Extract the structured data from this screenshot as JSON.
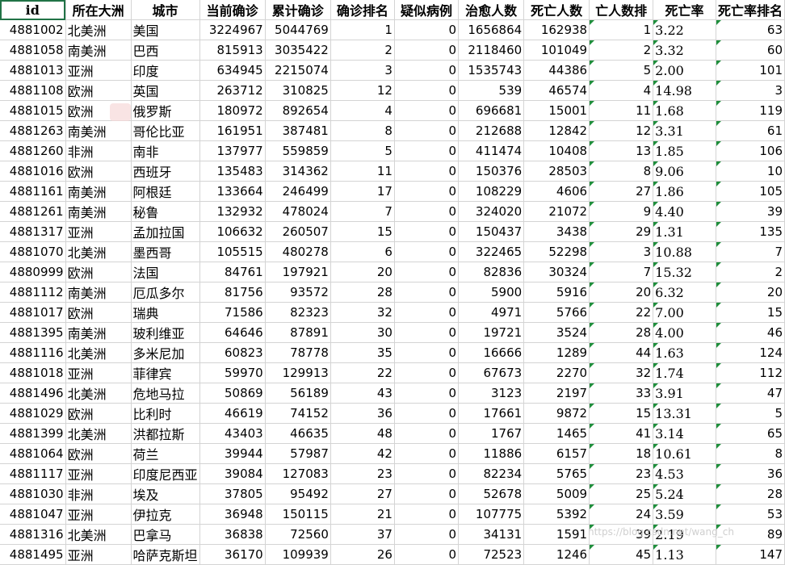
{
  "columns": [
    "id",
    "所在大洲",
    "城市",
    "当前确诊",
    "累计确诊",
    "确诊排名",
    "疑似病例",
    "治愈人数",
    "死亡人数",
    "亡人数排",
    "死亡率",
    "死亡率排名"
  ],
  "rows": [
    [
      "4881002",
      "北美洲",
      "美国",
      "3224967",
      "5044769",
      "1",
      "0",
      "1656864",
      "162938",
      "1",
      "3.22",
      "63"
    ],
    [
      "4881058",
      "南美洲",
      "巴西",
      "815913",
      "3035422",
      "2",
      "0",
      "2118460",
      "101049",
      "2",
      "3.32",
      "60"
    ],
    [
      "4881013",
      "亚洲",
      "印度",
      "634945",
      "2215074",
      "3",
      "0",
      "1535743",
      "44386",
      "5",
      "2.00",
      "101"
    ],
    [
      "4881108",
      "欧洲",
      "英国",
      "263712",
      "310825",
      "12",
      "0",
      "539",
      "46574",
      "4",
      "14.98",
      "3"
    ],
    [
      "4881015",
      "欧洲",
      "俄罗斯",
      "180972",
      "892654",
      "4",
      "0",
      "696681",
      "15001",
      "11",
      "1.68",
      "119"
    ],
    [
      "4881263",
      "南美洲",
      "哥伦比亚",
      "161951",
      "387481",
      "8",
      "0",
      "212688",
      "12842",
      "12",
      "3.31",
      "61"
    ],
    [
      "4881260",
      "非洲",
      "南非",
      "137977",
      "559859",
      "5",
      "0",
      "411474",
      "10408",
      "13",
      "1.85",
      "106"
    ],
    [
      "4881016",
      "欧洲",
      "西班牙",
      "135483",
      "314362",
      "11",
      "0",
      "150376",
      "28503",
      "8",
      "9.06",
      "10"
    ],
    [
      "4881161",
      "南美洲",
      "阿根廷",
      "133664",
      "246499",
      "17",
      "0",
      "108229",
      "4606",
      "27",
      "1.86",
      "105"
    ],
    [
      "4881261",
      "南美洲",
      "秘鲁",
      "132932",
      "478024",
      "7",
      "0",
      "324020",
      "21072",
      "9",
      "4.40",
      "39"
    ],
    [
      "4881317",
      "亚洲",
      "孟加拉国",
      "106632",
      "260507",
      "15",
      "0",
      "150437",
      "3438",
      "29",
      "1.31",
      "135"
    ],
    [
      "4881070",
      "北美洲",
      "墨西哥",
      "105515",
      "480278",
      "6",
      "0",
      "322465",
      "52298",
      "3",
      "10.88",
      "7"
    ],
    [
      "4880999",
      "欧洲",
      "法国",
      "84761",
      "197921",
      "20",
      "0",
      "82836",
      "30324",
      "7",
      "15.32",
      "2"
    ],
    [
      "4881112",
      "南美洲",
      "厄瓜多尔",
      "81756",
      "93572",
      "28",
      "0",
      "5900",
      "5916",
      "20",
      "6.32",
      "20"
    ],
    [
      "4881017",
      "欧洲",
      "瑞典",
      "71586",
      "82323",
      "32",
      "0",
      "4971",
      "5766",
      "22",
      "7.00",
      "15"
    ],
    [
      "4881395",
      "南美洲",
      "玻利维亚",
      "64646",
      "87891",
      "30",
      "0",
      "19721",
      "3524",
      "28",
      "4.00",
      "46"
    ],
    [
      "4881116",
      "北美洲",
      "多米尼加",
      "60823",
      "78778",
      "35",
      "0",
      "16666",
      "1289",
      "44",
      "1.63",
      "124"
    ],
    [
      "4881018",
      "亚洲",
      "菲律宾",
      "59970",
      "129913",
      "22",
      "0",
      "67673",
      "2270",
      "32",
      "1.74",
      "112"
    ],
    [
      "4881496",
      "北美洲",
      "危地马拉",
      "50869",
      "56189",
      "43",
      "0",
      "3123",
      "2197",
      "33",
      "3.91",
      "47"
    ],
    [
      "4881029",
      "欧洲",
      "比利时",
      "46619",
      "74152",
      "36",
      "0",
      "17661",
      "9872",
      "15",
      "13.31",
      "5"
    ],
    [
      "4881399",
      "北美洲",
      "洪都拉斯",
      "43403",
      "46635",
      "48",
      "0",
      "1767",
      "1465",
      "41",
      "3.14",
      "65"
    ],
    [
      "4881064",
      "欧洲",
      "荷兰",
      "39944",
      "57987",
      "42",
      "0",
      "11886",
      "6157",
      "18",
      "10.61",
      "8"
    ],
    [
      "4881117",
      "亚洲",
      "印度尼西亚",
      "39084",
      "127083",
      "23",
      "0",
      "82234",
      "5765",
      "23",
      "4.53",
      "36"
    ],
    [
      "4881030",
      "非洲",
      "埃及",
      "37805",
      "95492",
      "27",
      "0",
      "52678",
      "5009",
      "25",
      "5.24",
      "28"
    ],
    [
      "4881047",
      "亚洲",
      "伊拉克",
      "36948",
      "150115",
      "21",
      "0",
      "107775",
      "5392",
      "24",
      "3.59",
      "53"
    ],
    [
      "4881316",
      "北美洲",
      "巴拿马",
      "36838",
      "72560",
      "37",
      "0",
      "34131",
      "1591",
      "39",
      "2.19",
      "89"
    ],
    [
      "4881495",
      "亚洲",
      "哈萨克斯坦",
      "36170",
      "109939",
      "26",
      "0",
      "72523",
      "1246",
      "45",
      "1.13",
      "147"
    ]
  ],
  "watermark": "https://blog.csdn.net/wang_ch",
  "colors": {
    "grid": "#d4d4d4",
    "selection": "#217346",
    "error_flag": "#1f8f3c"
  }
}
